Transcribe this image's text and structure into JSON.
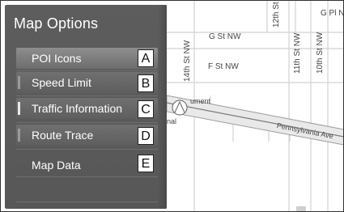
{
  "panel": {
    "title": "Map Options"
  },
  "menu": {
    "items": [
      {
        "label": "POI Icons",
        "callout": "A"
      },
      {
        "label": "Speed Limit",
        "callout": "B"
      },
      {
        "label": "Traffic Information",
        "callout": "C"
      },
      {
        "label": "Route Trace",
        "callout": "D"
      },
      {
        "label": "Map Data",
        "callout": "E"
      }
    ]
  },
  "map": {
    "streets": {
      "g_st_nw": "G St NW",
      "f_st_nw": "F St NW",
      "st14_nw": "14th St NW",
      "st12": "12th St",
      "st11_nw": "11th St NW",
      "st10_nw": "10th St NW",
      "g_pl": "G Pl N",
      "pennsylvania": "Pennsylvania Ave",
      "monument": "ument",
      "national": "nal"
    }
  }
}
